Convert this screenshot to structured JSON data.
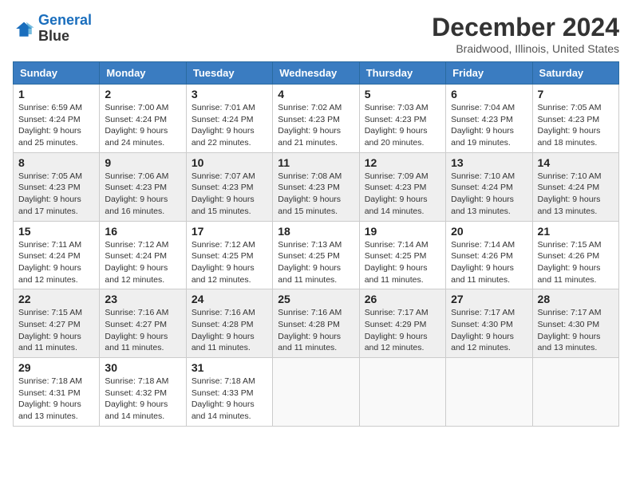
{
  "header": {
    "logo_line1": "General",
    "logo_line2": "Blue",
    "month_title": "December 2024",
    "location": "Braidwood, Illinois, United States"
  },
  "weekdays": [
    "Sunday",
    "Monday",
    "Tuesday",
    "Wednesday",
    "Thursday",
    "Friday",
    "Saturday"
  ],
  "weeks": [
    [
      {
        "day": "1",
        "sunrise": "6:59 AM",
        "sunset": "4:24 PM",
        "daylight": "9 hours and 25 minutes."
      },
      {
        "day": "2",
        "sunrise": "7:00 AM",
        "sunset": "4:24 PM",
        "daylight": "9 hours and 24 minutes."
      },
      {
        "day": "3",
        "sunrise": "7:01 AM",
        "sunset": "4:24 PM",
        "daylight": "9 hours and 22 minutes."
      },
      {
        "day": "4",
        "sunrise": "7:02 AM",
        "sunset": "4:23 PM",
        "daylight": "9 hours and 21 minutes."
      },
      {
        "day": "5",
        "sunrise": "7:03 AM",
        "sunset": "4:23 PM",
        "daylight": "9 hours and 20 minutes."
      },
      {
        "day": "6",
        "sunrise": "7:04 AM",
        "sunset": "4:23 PM",
        "daylight": "9 hours and 19 minutes."
      },
      {
        "day": "7",
        "sunrise": "7:05 AM",
        "sunset": "4:23 PM",
        "daylight": "9 hours and 18 minutes."
      }
    ],
    [
      {
        "day": "8",
        "sunrise": "7:05 AM",
        "sunset": "4:23 PM",
        "daylight": "9 hours and 17 minutes."
      },
      {
        "day": "9",
        "sunrise": "7:06 AM",
        "sunset": "4:23 PM",
        "daylight": "9 hours and 16 minutes."
      },
      {
        "day": "10",
        "sunrise": "7:07 AM",
        "sunset": "4:23 PM",
        "daylight": "9 hours and 15 minutes."
      },
      {
        "day": "11",
        "sunrise": "7:08 AM",
        "sunset": "4:23 PM",
        "daylight": "9 hours and 15 minutes."
      },
      {
        "day": "12",
        "sunrise": "7:09 AM",
        "sunset": "4:23 PM",
        "daylight": "9 hours and 14 minutes."
      },
      {
        "day": "13",
        "sunrise": "7:10 AM",
        "sunset": "4:24 PM",
        "daylight": "9 hours and 13 minutes."
      },
      {
        "day": "14",
        "sunrise": "7:10 AM",
        "sunset": "4:24 PM",
        "daylight": "9 hours and 13 minutes."
      }
    ],
    [
      {
        "day": "15",
        "sunrise": "7:11 AM",
        "sunset": "4:24 PM",
        "daylight": "9 hours and 12 minutes."
      },
      {
        "day": "16",
        "sunrise": "7:12 AM",
        "sunset": "4:24 PM",
        "daylight": "9 hours and 12 minutes."
      },
      {
        "day": "17",
        "sunrise": "7:12 AM",
        "sunset": "4:25 PM",
        "daylight": "9 hours and 12 minutes."
      },
      {
        "day": "18",
        "sunrise": "7:13 AM",
        "sunset": "4:25 PM",
        "daylight": "9 hours and 11 minutes."
      },
      {
        "day": "19",
        "sunrise": "7:14 AM",
        "sunset": "4:25 PM",
        "daylight": "9 hours and 11 minutes."
      },
      {
        "day": "20",
        "sunrise": "7:14 AM",
        "sunset": "4:26 PM",
        "daylight": "9 hours and 11 minutes."
      },
      {
        "day": "21",
        "sunrise": "7:15 AM",
        "sunset": "4:26 PM",
        "daylight": "9 hours and 11 minutes."
      }
    ],
    [
      {
        "day": "22",
        "sunrise": "7:15 AM",
        "sunset": "4:27 PM",
        "daylight": "9 hours and 11 minutes."
      },
      {
        "day": "23",
        "sunrise": "7:16 AM",
        "sunset": "4:27 PM",
        "daylight": "9 hours and 11 minutes."
      },
      {
        "day": "24",
        "sunrise": "7:16 AM",
        "sunset": "4:28 PM",
        "daylight": "9 hours and 11 minutes."
      },
      {
        "day": "25",
        "sunrise": "7:16 AM",
        "sunset": "4:28 PM",
        "daylight": "9 hours and 11 minutes."
      },
      {
        "day": "26",
        "sunrise": "7:17 AM",
        "sunset": "4:29 PM",
        "daylight": "9 hours and 12 minutes."
      },
      {
        "day": "27",
        "sunrise": "7:17 AM",
        "sunset": "4:30 PM",
        "daylight": "9 hours and 12 minutes."
      },
      {
        "day": "28",
        "sunrise": "7:17 AM",
        "sunset": "4:30 PM",
        "daylight": "9 hours and 13 minutes."
      }
    ],
    [
      {
        "day": "29",
        "sunrise": "7:18 AM",
        "sunset": "4:31 PM",
        "daylight": "9 hours and 13 minutes."
      },
      {
        "day": "30",
        "sunrise": "7:18 AM",
        "sunset": "4:32 PM",
        "daylight": "9 hours and 14 minutes."
      },
      {
        "day": "31",
        "sunrise": "7:18 AM",
        "sunset": "4:33 PM",
        "daylight": "9 hours and 14 minutes."
      },
      null,
      null,
      null,
      null
    ]
  ]
}
